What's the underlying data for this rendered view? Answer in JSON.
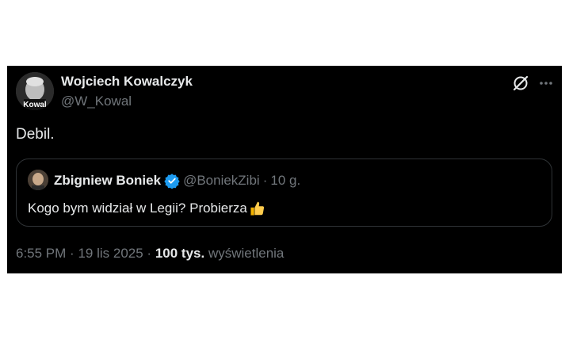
{
  "author": {
    "name": "Wojciech Kowalczyk",
    "handle": "@W_Kowal",
    "avatar_text": "Kowal"
  },
  "tweet": {
    "text": "Debil."
  },
  "quoted": {
    "name": "Zbigniew Boniek",
    "handle": "@BoniekZibi",
    "separator": "·",
    "time": "10 g.",
    "text": "Kogo bym widział w Legii? Probierza",
    "emoji": "thumbs-up"
  },
  "meta": {
    "time": "6:55 PM",
    "sep1": "·",
    "date": "19 lis 2025",
    "sep2": "·",
    "views_count": "100 tys.",
    "views_label": "wyświetlenia"
  },
  "icons": {
    "verified": "verified-badge-icon",
    "grok": "grok-icon",
    "more": "more-icon"
  },
  "colors": {
    "background": "#000000",
    "text": "#e7e9ea",
    "secondary": "#71767b",
    "verified": "#1d9bf0",
    "border": "#2f3336"
  }
}
